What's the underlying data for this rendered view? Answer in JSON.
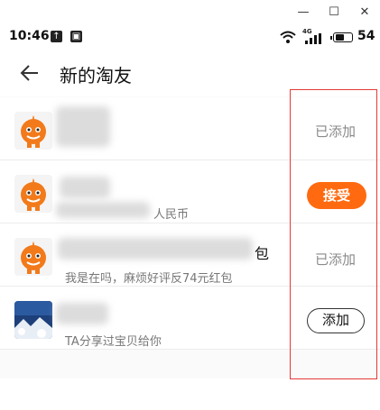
{
  "status_bar": {
    "time": "10:46",
    "signal_label": "4G",
    "battery_percent": "54",
    "battery_level": 0.54
  },
  "header": {
    "title": "新的淘友"
  },
  "friends": [
    {
      "status": "已添加",
      "subtitle": ""
    },
    {
      "action": "接受",
      "subtitle": "人民币"
    },
    {
      "status": "已添加",
      "subtitle": "我是在吗，麻烦好评反74元红包",
      "name_suffix": "包"
    },
    {
      "action": "添加",
      "subtitle": "TA分享过宝贝给你"
    }
  ],
  "colors": {
    "accent": "#ff6a10",
    "highlight_box": "#e53935"
  },
  "icons": [
    "back-arrow-icon",
    "wifi-icon",
    "signal-icon",
    "battery-icon",
    "minimize-icon",
    "maximize-icon",
    "close-icon"
  ]
}
